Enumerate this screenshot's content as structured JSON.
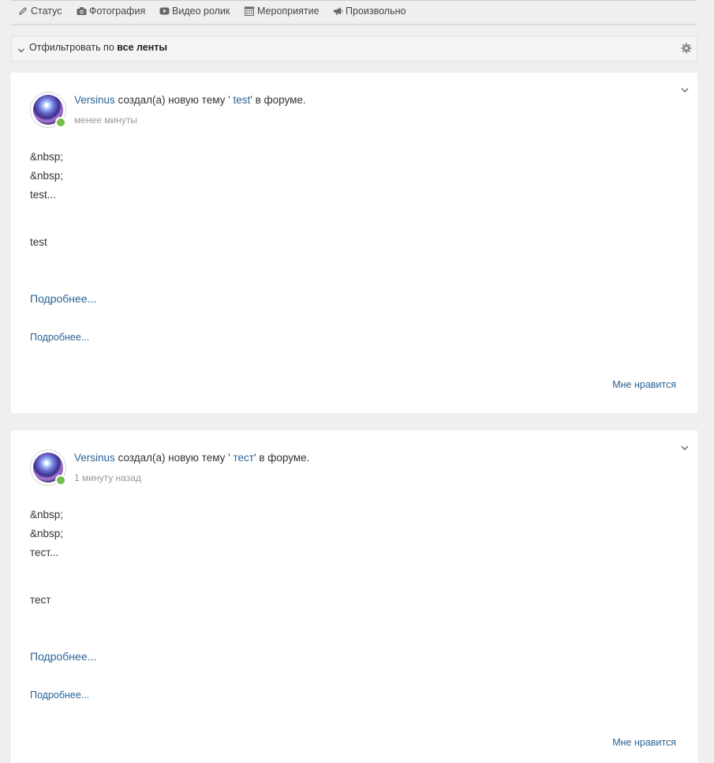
{
  "composer": {
    "tabs": [
      {
        "label": "Статус",
        "icon": "pencil-icon"
      },
      {
        "label": "Фотография",
        "icon": "camera-icon"
      },
      {
        "label": "Видео ролик",
        "icon": "video-icon"
      },
      {
        "label": "Мероприятие",
        "icon": "calendar-icon"
      },
      {
        "label": "Произвольно",
        "icon": "megaphone-icon"
      }
    ]
  },
  "filter": {
    "prefix": "Отфильтровать по",
    "value": "все ленты"
  },
  "colors": {
    "link": "#2a6496",
    "online": "#72c04a",
    "muted": "#999999",
    "background": "#efefef"
  },
  "posts": [
    {
      "author": "Versinus",
      "action": "создал(а) новую тему",
      "quote_open": "' ",
      "topic": "test",
      "quote_close": "'",
      "suffix": "в форуме.",
      "time": "менее минуты",
      "lines": [
        "&nbsp;",
        "&nbsp;",
        "test..."
      ],
      "extra": "test",
      "read_more_large": "Подробнее...",
      "read_more_small": "Подробнее...",
      "like": "Мне нравится"
    },
    {
      "author": "Versinus",
      "action": "создал(а) новую тему",
      "quote_open": "' ",
      "topic": "тест",
      "quote_close": "'",
      "suffix": "в форуме.",
      "time": "1 минуту назад",
      "lines": [
        "&nbsp;",
        "&nbsp;",
        "тест..."
      ],
      "extra": "тест",
      "read_more_large": "Подробнее...",
      "read_more_small": "Подробнее...",
      "like": "Мне нравится"
    }
  ]
}
